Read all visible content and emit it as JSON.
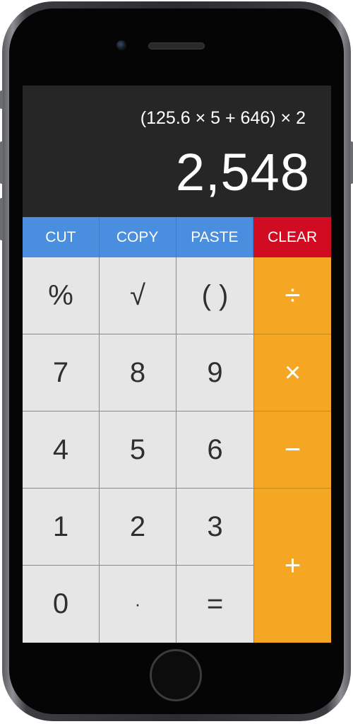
{
  "display": {
    "expression": "(125.6 × 5 + 646) × 2",
    "result": "2,548"
  },
  "edit_buttons": {
    "cut": "CUT",
    "copy": "COPY",
    "paste": "PASTE",
    "clear": "CLEAR"
  },
  "keys": {
    "percent": "%",
    "sqrt": "√",
    "parens": "( )",
    "divide": "÷",
    "seven": "7",
    "eight": "8",
    "nine": "9",
    "multiply": "×",
    "four": "4",
    "five": "5",
    "six": "6",
    "minus": "−",
    "one": "1",
    "two": "2",
    "three": "3",
    "plus": "+",
    "zero": "0",
    "decimal": "·",
    "equals": "="
  },
  "colors": {
    "edit_blue": "#4a8fdf",
    "clear_red": "#d10b22",
    "operator_orange": "#f5a623",
    "key_gray": "#e6e6e6",
    "display_bg": "#262626"
  }
}
